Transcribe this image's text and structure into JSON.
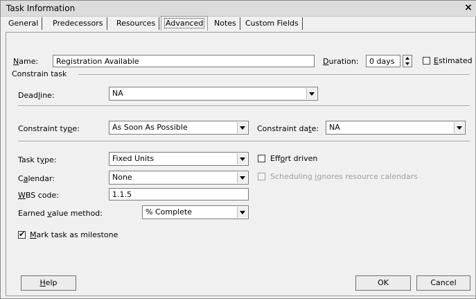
{
  "window": {
    "title": "Task Information",
    "close": "×"
  },
  "tabs": [
    "General",
    "Predecessors",
    "Resources",
    "Advanced",
    "Notes",
    "Custom Fields"
  ],
  "active_tab": "Advanced",
  "name": {
    "label_key": "N",
    "label_rest": "ame:",
    "value": "Registration Available"
  },
  "duration": {
    "label_key": "D",
    "label_rest": "uration:",
    "value": "0 days"
  },
  "estimated": {
    "label_key": "E",
    "label_rest": "stimated",
    "checked": false
  },
  "constrain_task": {
    "heading": "Constrain task"
  },
  "deadline": {
    "label_a": "Dead",
    "label_key": "l",
    "label_b": "ine:",
    "value": "NA"
  },
  "constraint_type": {
    "label_a": "Constraint ty",
    "label_key": "p",
    "label_b": "e:",
    "value": "As Soon As Possible"
  },
  "constraint_date": {
    "label_a": "Constraint da",
    "label_key": "t",
    "label_b": "e:",
    "value": "NA"
  },
  "task_type": {
    "label_a": "Task t",
    "label_key": "y",
    "label_b": "pe:",
    "value": "Fixed Units"
  },
  "effort_driven": {
    "label_a": "Eff",
    "label_key": "o",
    "label_b": "rt driven",
    "checked": false
  },
  "calendar": {
    "label_a": "C",
    "label_key": "a",
    "label_b": "lendar:",
    "value": "None"
  },
  "scheduling_ignores": {
    "label_a": "Scheduling ",
    "label_key": "i",
    "label_b": "gnores resource calendars",
    "checked": false,
    "disabled": true
  },
  "wbs": {
    "label_key": "W",
    "label_rest": "BS code:",
    "value": "1.1.5"
  },
  "earned_value": {
    "label_a": "Earned ",
    "label_key": "v",
    "label_b": "alue method:",
    "value": "% Complete"
  },
  "milestone": {
    "label_key": "M",
    "label_rest": "ark task as milestone",
    "checked": true,
    "check_glyph": "✔"
  },
  "buttons": {
    "help_key": "H",
    "help_rest": "elp",
    "ok": "OK",
    "cancel": "Cancel"
  }
}
